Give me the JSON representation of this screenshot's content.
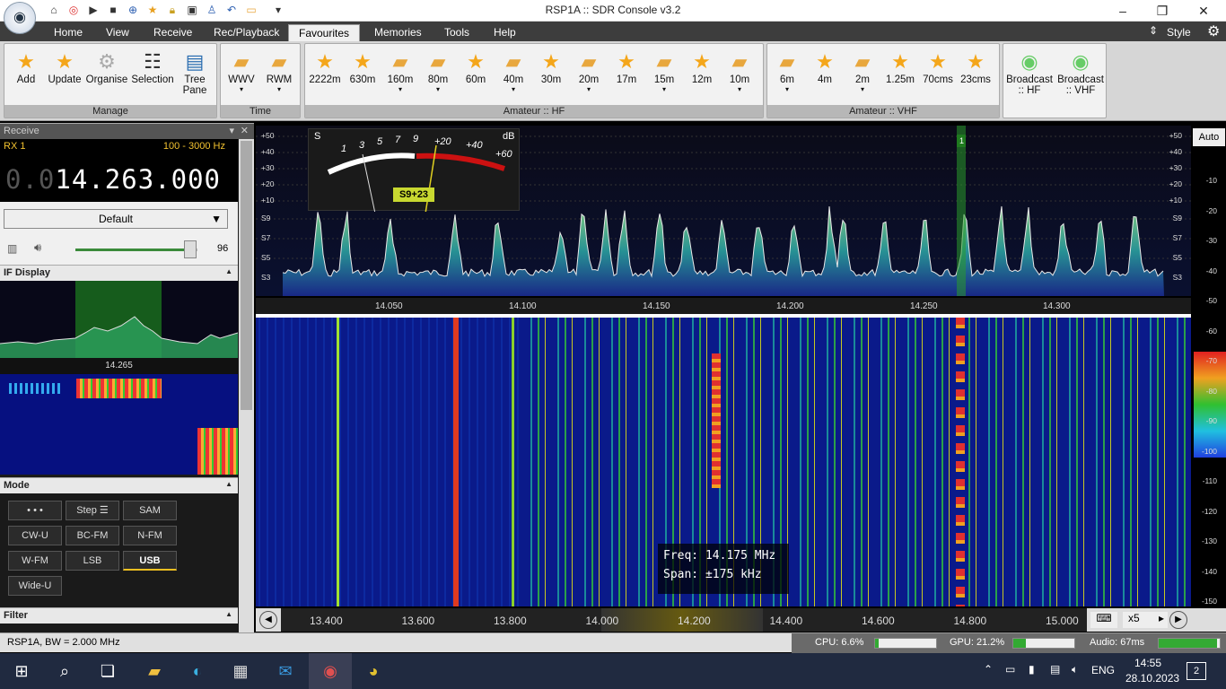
{
  "window": {
    "title": "RSP1A :: SDR Console v3.2",
    "style_label": "Style",
    "minimize": "–",
    "restore": "❐",
    "close": "✕"
  },
  "menu": [
    "Home",
    "View",
    "Receive",
    "Rec/Playback",
    "Favourites",
    "Memories",
    "Tools",
    "Help"
  ],
  "ribbon": {
    "manage": {
      "label": "Manage",
      "buttons": [
        "Add",
        "Update",
        "Organise",
        "Selection",
        "Tree Pane"
      ]
    },
    "time": {
      "label": "Time",
      "buttons": [
        "WWV",
        "RWM"
      ]
    },
    "hf": {
      "label": "Amateur :: HF",
      "buttons": [
        "2222m",
        "630m",
        "160m",
        "80m",
        "60m",
        "40m",
        "30m",
        "20m",
        "17m",
        "15m",
        "12m",
        "10m"
      ]
    },
    "vhf": {
      "label": "Amateur :: VHF",
      "buttons": [
        "6m",
        "4m",
        "2m",
        "1.25m",
        "70cms",
        "23cms"
      ]
    },
    "broadcast": [
      "Broadcast :: HF",
      "Broadcast :: VHF"
    ]
  },
  "receive_panel": {
    "header": "Receive",
    "rx": "RX 1",
    "bandwidth": "100 - 3000 Hz",
    "freq_dim": "0.0",
    "freq_main": "14.263.000",
    "preset": "Default",
    "volume": "96",
    "volume_level": 0.96
  },
  "if_display": {
    "header": "IF Display",
    "freq": "14.265"
  },
  "mode": {
    "header": "Mode",
    "buttons": [
      "• • •",
      "Step ☰",
      "SAM",
      "CW-U",
      "BC-FM",
      "N-FM",
      "W-FM",
      "LSB",
      "USB",
      "Wide-U"
    ],
    "selected": "USB"
  },
  "filter": {
    "header": "Filter"
  },
  "spectrum": {
    "left_scale": [
      "+50",
      "+40",
      "+30",
      "+20",
      "+10",
      "S9",
      "S7",
      "S5",
      "S3"
    ],
    "right_scale": [
      "+50",
      "+40",
      "+30",
      "+20",
      "+10",
      "S9",
      "S7",
      "S5",
      "S3"
    ],
    "freq_ticks": [
      "14.050",
      "14.100",
      "14.150",
      "14.200",
      "14.250",
      "14.300"
    ],
    "marker": "1",
    "smeter": {
      "s_label": "S",
      "db_label": "dB",
      "s_ticks": [
        "1",
        "3",
        "5",
        "7",
        "9"
      ],
      "db_ticks": [
        "+20",
        "+40",
        "+60"
      ],
      "reading": "S9+23"
    }
  },
  "waterfall": {
    "freq_label": "Freq:",
    "freq_value": "14.175 MHz",
    "span_label": "Span:",
    "span_value": "±175 kHz"
  },
  "right_scale": {
    "auto": "Auto",
    "values": [
      "-10",
      "-20",
      "-30",
      "-40",
      "-50",
      "-60",
      "-70",
      "-80",
      "-90",
      "-100",
      "-110",
      "-120",
      "-130",
      "-140",
      "-150"
    ]
  },
  "overview": {
    "ticks": [
      "13.400",
      "13.600",
      "13.800",
      "14.000",
      "14.200",
      "14.400",
      "14.600",
      "14.800",
      "15.000"
    ],
    "zoom": "x5"
  },
  "status": {
    "device": "RSP1A, BW = 2.000 MHz",
    "cpu": "CPU: 6.6%",
    "cpu_level": 0.066,
    "gpu": "GPU: 21.2%",
    "gpu_level": 0.212,
    "audio": "Audio: 67ms",
    "audio_level": 0.95
  },
  "taskbar": {
    "lang": "ENG",
    "time": "14:55",
    "date": "28.10.2023",
    "notifications": "2"
  },
  "colors": {
    "accent": "#f2c230",
    "menubar": "#3d3d3d",
    "waterfall_bg": "#0a1a8a"
  }
}
